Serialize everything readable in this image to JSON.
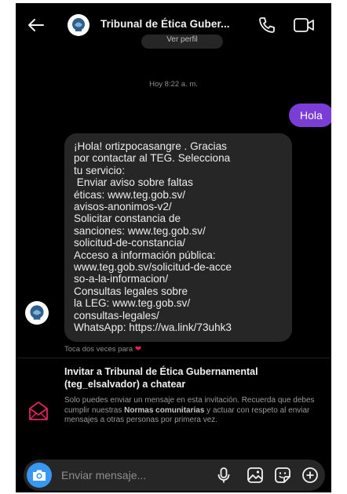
{
  "header": {
    "title": "Tribunal de Ética Guber...",
    "prev_pill": "Ver perfil"
  },
  "timestamp": "Hoy 8:22 a. m.",
  "sent_message": "Hola",
  "received_message_lines": [
    "¡Hola! ortizpocasangre . Gracias",
    "por contactar al TEG. Selecciona",
    "tu servicio:",
    " Enviar aviso sobre faltas",
    "éticas: www.teg.gob.sv/",
    "avisos-anonimos-v2/",
    "Solicitar constancia de",
    "sanciones: www.teg.gob.sv/",
    "solicitud-de-constancia/",
    "Acceso a información pública:",
    "www.teg.gob.sv/solicitud-de-acce",
    "so-a-la-informacion/",
    "Consultas legales sobre",
    "la LEG: www.teg.gob.sv/",
    "consultas-legales/",
    "WhatsApp: https://wa.link/73uhk3"
  ],
  "reaction_text": "Toca dos veces para",
  "invite": {
    "title": "Invitar a Tribunal de Ética Gubernamental (teg_elsalvador) a chatear",
    "body_pre": "Solo puedes enviar un mensaje en esta invitación. Recuerda que debes cumplir nuestras ",
    "body_bold": "Normas comunitarias",
    "body_post": " y actuar con respeto al enviar mensajes a otras personas por primera vez."
  },
  "composer": {
    "placeholder": "Enviar mensaje..."
  },
  "icons": {
    "back": "back-arrow-icon",
    "phone": "phone-icon",
    "video": "video-camera-icon",
    "camera": "camera-icon",
    "mic": "microphone-icon",
    "gallery": "gallery-icon",
    "sticker": "sticker-icon",
    "add": "plus-circle-icon",
    "invite": "envelope-icon"
  },
  "colors": {
    "background": "#000000",
    "sent_bubble": "#7a3dd6",
    "received_bubble": "#262626",
    "camera_button": "#3897f0",
    "heart": "#e0245e"
  }
}
